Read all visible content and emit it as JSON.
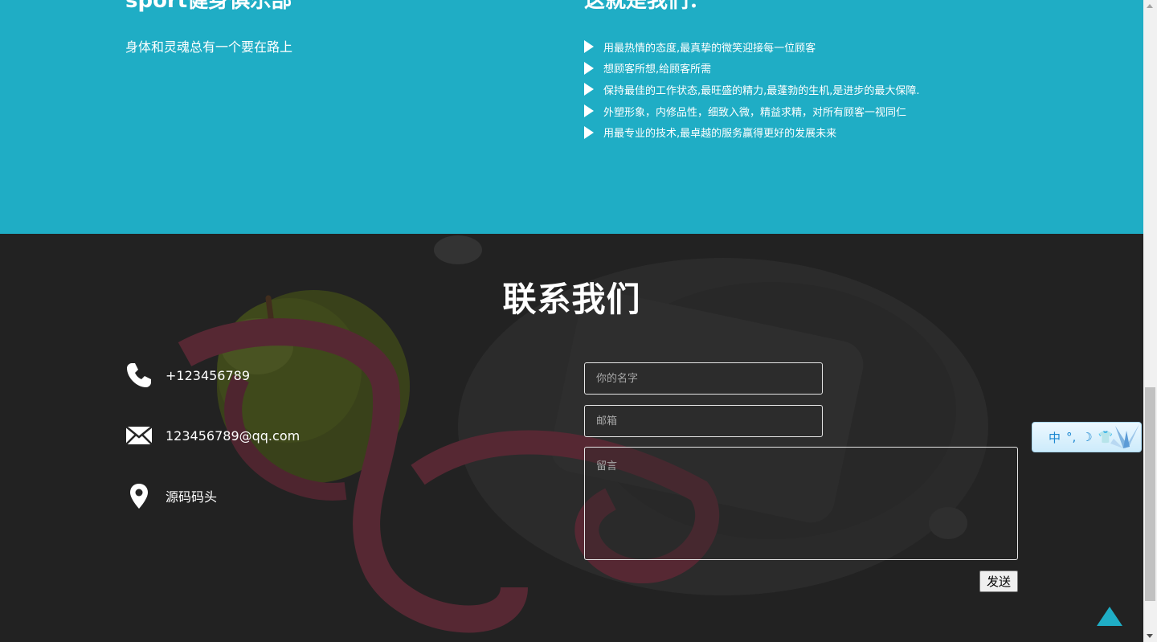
{
  "about": {
    "title_left": "sport健身俱乐部",
    "title_right": "这就是我们：",
    "slogan": "身体和灵魂总有一个要在路上",
    "values": [
      "用最热情的态度,最真挚的微笑迎接每一位顾客",
      "想顾客所想,给顾客所需",
      "保持最佳的工作状态,最旺盛的精力,最蓬勃的生机,是进步的最大保障.",
      "外塑形象，内修品性，细致入微，精益求精，对所有顾客一视同仁",
      "用最专业的技术,最卓越的服务赢得更好的发展未来"
    ]
  },
  "contact": {
    "title": "联系我们",
    "phone": "+123456789",
    "email": "123456789@qq.com",
    "address": "源码码头",
    "form": {
      "name_placeholder": "你的名字",
      "email_placeholder": "邮箱",
      "message_placeholder": "留言",
      "send_label": "发送"
    }
  },
  "ime_toolbar": {
    "mode_label": "中",
    "icons": [
      "punctuation-icon",
      "moon-icon",
      "shirt-icon",
      "flower-icon"
    ]
  },
  "colors": {
    "teal": "#1fadc5",
    "dark": "#262626"
  }
}
